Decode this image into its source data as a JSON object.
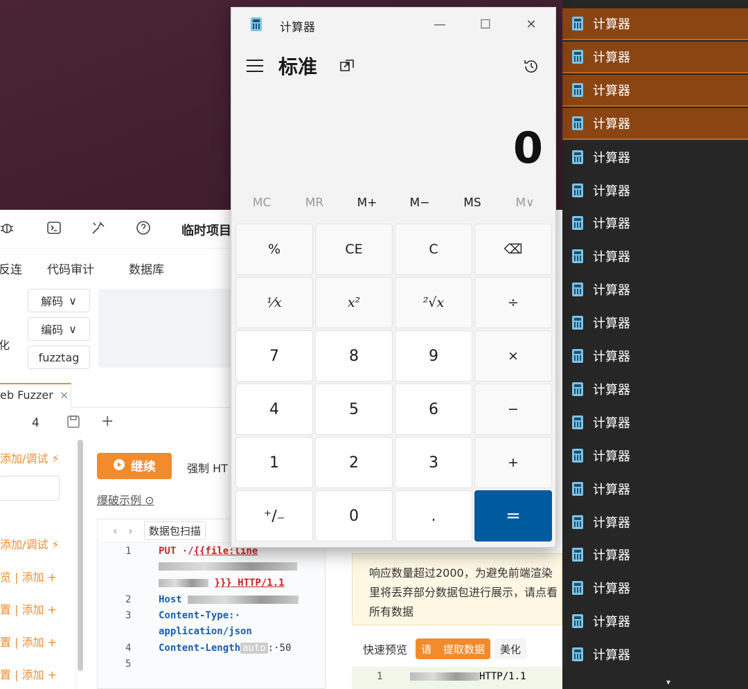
{
  "calculator": {
    "window_title": "计算器",
    "mode": "标准",
    "display": "0",
    "memory": [
      "MC",
      "MR",
      "M+",
      "M−",
      "MS",
      "M∨"
    ],
    "keys": [
      "%",
      "CE",
      "C",
      "⌫",
      "⅟x",
      "x²",
      "²√x",
      "÷",
      "7",
      "8",
      "9",
      "×",
      "4",
      "5",
      "6",
      "−",
      "1",
      "2",
      "3",
      "+",
      "⁺∕₋",
      "0",
      ".",
      "="
    ],
    "win_controls": {
      "minimize": "—",
      "maximize": "☐",
      "close": "✕"
    }
  },
  "taskbar_group": {
    "label": "计算器",
    "count": 20,
    "highlighted": [
      0,
      1,
      2,
      3
    ],
    "highlight_color": "#8b4513"
  },
  "bgapp": {
    "project_title": "临时项目",
    "menu": [
      "反连",
      "代码审计",
      "数据库"
    ],
    "side_buttons": [
      "解码",
      "编码",
      "fuzztag"
    ],
    "side_label": "化",
    "tab": "eb Fuzzer",
    "tab_close": "×",
    "row2_number": "4",
    "row2_plus": "+",
    "left_items": [
      "添加/调试 ⚡",
      "添加/调试 ⚡",
      "览 | 添加 +",
      "置 | 添加 +",
      "置 | 添加 +",
      "置 | 添加 +"
    ],
    "continue_button": "继续",
    "force_label": "强制 HT",
    "example_link": "爆破示例",
    "editor_tag": "数据包扫描",
    "code_lines": [
      {
        "n": "1",
        "t": "PUT ·/"
      },
      {
        "n": "",
        "t": "{{file:line"
      },
      {
        "n": "",
        "t": "}}} HTTP/1.1"
      },
      {
        "n": "2",
        "t": "Host"
      },
      {
        "n": "3",
        "t": "Content-Type:·"
      },
      {
        "n": "",
        "t": "application/json"
      },
      {
        "n": "4",
        "t": "Content-Length"
      },
      {
        "n": "",
        "t": "auto"
      },
      {
        "n": "",
        "t": ":·50"
      },
      {
        "n": "5",
        "t": ""
      }
    ],
    "response_notice": "响应数量超过2000，为避免前端渲染里将丢弃部分数据包进行展示，请点看所有数据",
    "quick_preview": "快速预览",
    "quick_buttons": [
      "请",
      "提取数据",
      "美化"
    ],
    "resp_line_no": "1",
    "resp_line": "HTTP/1.1",
    "accent": "#f28b2c"
  }
}
